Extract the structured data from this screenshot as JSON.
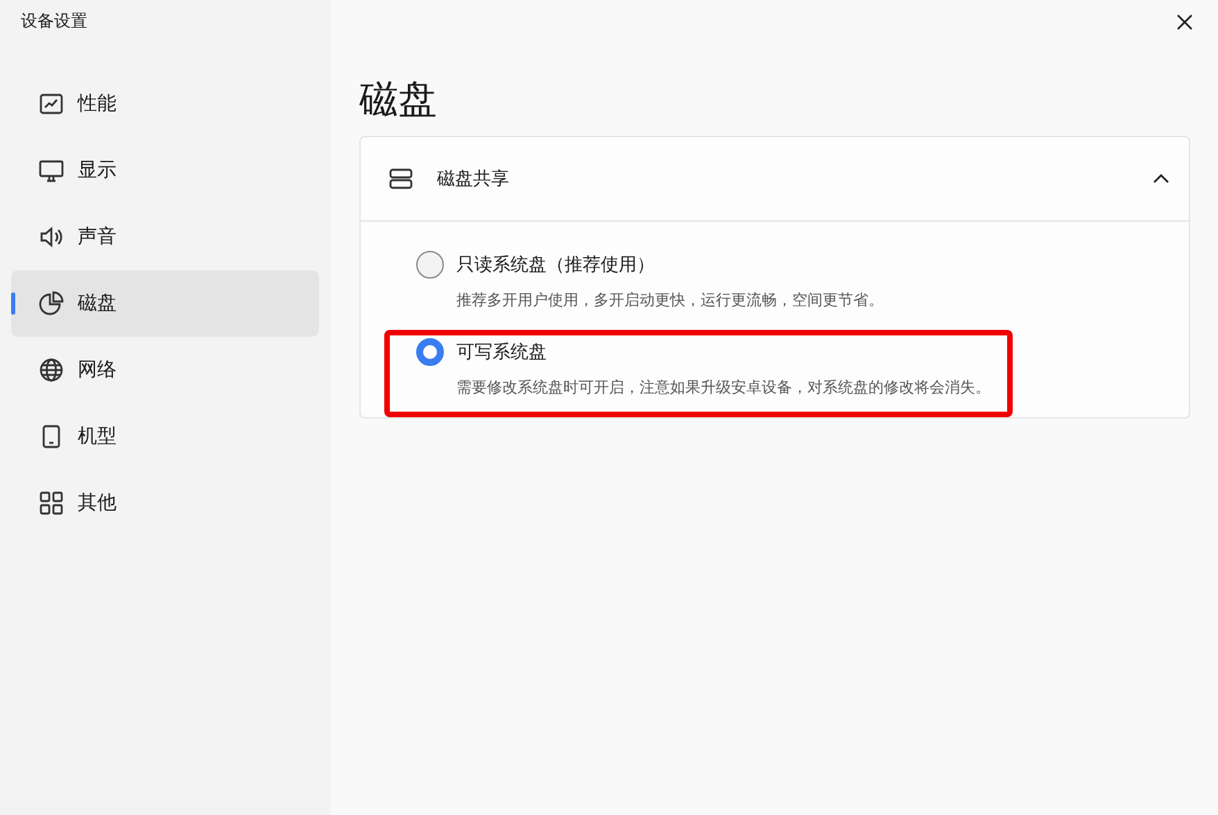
{
  "window": {
    "title": "设备设置"
  },
  "sidebar": {
    "items": [
      {
        "label": "性能",
        "selected": false
      },
      {
        "label": "显示",
        "selected": false
      },
      {
        "label": "声音",
        "selected": false
      },
      {
        "label": "磁盘",
        "selected": true
      },
      {
        "label": "网络",
        "selected": false
      },
      {
        "label": "机型",
        "selected": false
      },
      {
        "label": "其他",
        "selected": false
      }
    ]
  },
  "page": {
    "heading": "磁盘",
    "section": {
      "title": "磁盘共享",
      "expanded": true,
      "options": [
        {
          "label": "只读系统盘（推荐使用）",
          "description": "推荐多开用户使用，多开启动更快，运行更流畅，空间更节省。",
          "selected": false,
          "highlighted": false
        },
        {
          "label": "可写系统盘",
          "description": "需要修改系统盘时可开启，注意如果升级安卓设备，对系统盘的修改将会消失。",
          "selected": true,
          "highlighted": true
        }
      ]
    }
  }
}
